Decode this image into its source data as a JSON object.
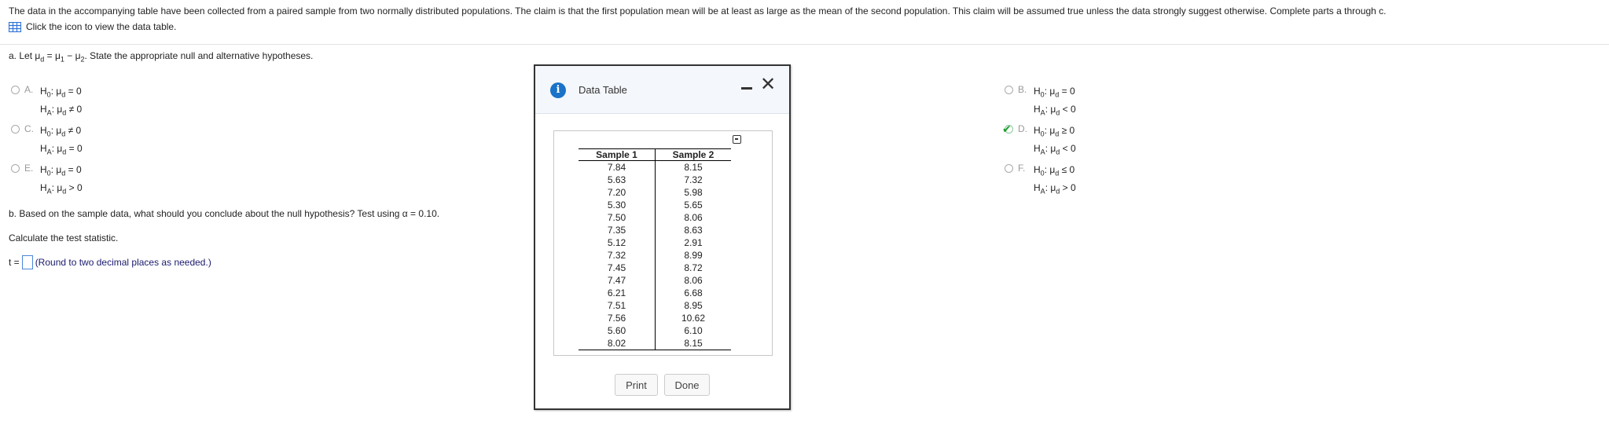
{
  "intro": "The data in the accompanying table have been collected from a paired sample from two normally distributed populations. The claim is that the first population mean will be at least as large as the mean of the second population. This claim will be assumed true unless the data strongly suggest otherwise. Complete parts a through c.",
  "view_link": "Click the icon to view the data table.",
  "part_a": {
    "prefix": "a. Let μ",
    "sub_d": "d",
    "mid": " = μ",
    "sub_1": "1",
    "minus": " − μ",
    "sub_2": "2",
    "suffix": ". State the appropriate null and alternative hypotheses."
  },
  "options": [
    {
      "letter": "A.",
      "h0": "= 0",
      "ha": "≠ 0",
      "selected": false
    },
    {
      "letter": "B.",
      "h0": "= 0",
      "ha": "< 0",
      "selected": false
    },
    {
      "letter": "C.",
      "h0": "≠ 0",
      "ha": "= 0",
      "selected": false
    },
    {
      "letter": "D.",
      "h0": "≥ 0",
      "ha": "< 0",
      "selected": true
    },
    {
      "letter": "E.",
      "h0": "= 0",
      "ha": "> 0",
      "selected": false
    },
    {
      "letter": "F.",
      "h0": "≤ 0",
      "ha": "> 0",
      "selected": false
    }
  ],
  "hyp_labels": {
    "h": "H",
    "zero": "0",
    "a": "A",
    "mu": "μ",
    "d": "d",
    "colon": ": "
  },
  "part_b": "b. Based on the sample data, what should you conclude about the null hypothesis? Test using α = 0.10.",
  "calc": "Calculate the test statistic.",
  "t_label": "t =",
  "t_value": "",
  "round_note": "(Round to two decimal places as needed.)",
  "dialog": {
    "title": "Data Table",
    "close": "✕",
    "print_label": "Print",
    "done_label": "Done",
    "headers": [
      "Sample 1",
      "Sample 2"
    ],
    "rows": [
      [
        "7.84",
        "8.15"
      ],
      [
        "5.63",
        "7.32"
      ],
      [
        "7.20",
        "5.98"
      ],
      [
        "5.30",
        "5.65"
      ],
      [
        "7.50",
        "8.06"
      ],
      [
        "7.35",
        "8.63"
      ],
      [
        "5.12",
        "2.91"
      ],
      [
        "7.32",
        "8.99"
      ],
      [
        "7.45",
        "8.72"
      ],
      [
        "7.47",
        "8.06"
      ],
      [
        "6.21",
        "6.68"
      ],
      [
        "7.51",
        "8.95"
      ],
      [
        "7.56",
        "10.62"
      ],
      [
        "5.60",
        "6.10"
      ],
      [
        "8.02",
        "8.15"
      ]
    ]
  },
  "colors": {
    "accent": "#1a73c8",
    "check": "#1c9c2c",
    "note": "#1a1a6e"
  }
}
